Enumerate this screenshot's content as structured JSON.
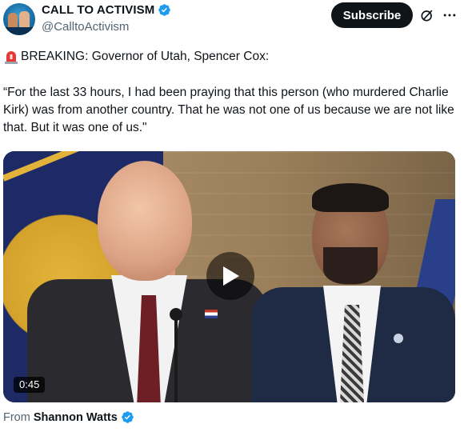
{
  "author": {
    "display_name": "CALL TO ACTIVISM",
    "handle": "@CalltoActivism",
    "verified": true
  },
  "actions": {
    "subscribe_label": "Subscribe",
    "grok_icon": "grok-icon",
    "more_icon": "more-horizontal-icon"
  },
  "tweet": {
    "emoji_icon": "police-light-icon",
    "line1": "BREAKING: Governor of Utah, Spencer Cox:",
    "quote": "“For the last 33 hours, I had been praying that this person (who murdered Charlie Kirk) was from another country. That he was not one of us because we are not like that. But it was one of us.\""
  },
  "video": {
    "duration": "0:45",
    "play_icon": "play-icon"
  },
  "attribution": {
    "prefix": "From",
    "source_name": "Shannon Watts",
    "verified": true
  },
  "colors": {
    "verified_blue": "#1d9bf0",
    "text_primary": "#0f1419",
    "text_secondary": "#536471",
    "button_dark": "#0f1419"
  }
}
